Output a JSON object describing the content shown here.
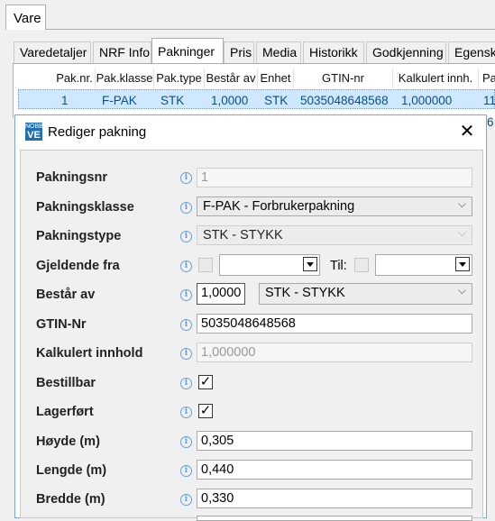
{
  "window": {
    "tab_label": "Vare"
  },
  "tabs": [
    "Varedetaljer",
    "NRF Info",
    "Pakninger",
    "Pris",
    "Media",
    "Historikk",
    "Godkjenning",
    "Egenskaper"
  ],
  "active_tab": "Pakninger",
  "grid": {
    "headers": [
      "Pak.nr.",
      "Pak.klasse",
      "Pak.type",
      "Består av",
      "Enhet",
      "GTIN-nr",
      "Kalkulert innh.",
      "Pa"
    ],
    "row": [
      "1",
      "F-PAK",
      "STK",
      "1,0000",
      "STK",
      "5035048648568",
      "1,000000",
      "11"
    ],
    "next_row_partial": "6"
  },
  "dialog": {
    "logo_top": "NOBB",
    "logo_bottom": "VE",
    "title": "Rediger pakning",
    "close_glyph": "✕",
    "info_glyph": "i",
    "labels": {
      "pakningsnr": "Pakningsnr",
      "pakningsklasse": "Pakningsklasse",
      "pakningstype": "Pakningstype",
      "gjeldende_fra": "Gjeldende fra",
      "til": "Til:",
      "bestar_av": "Består av",
      "gtin": "GTIN-Nr",
      "kalkulert": "Kalkulert innhold",
      "bestillbar": "Bestillbar",
      "lagerfort": "Lagerført",
      "hoyde": "Høyde (m)",
      "lengde": "Lengde (m)",
      "bredde": "Bredde (m)"
    },
    "values": {
      "pakningsnr": "1",
      "pakningsklasse": "F-PAK - Forbrukerpakning",
      "pakningstype": "STK - STYKK",
      "bestar_av_qty": "1,0000",
      "bestar_av_unit": "STK - STYKK",
      "gtin": "5035048648568",
      "kalkulert": "1,000000",
      "bestillbar_mark": "✓",
      "lagerfort_mark": "✓",
      "hoyde": "0,305",
      "lengde": "0,440",
      "bredde": "0,330"
    },
    "states": {
      "bestillbar": true,
      "lagerfort": true,
      "gjeldende_fra_checked": false,
      "til_checked": false
    },
    "chevron_glyph": "⌵"
  }
}
